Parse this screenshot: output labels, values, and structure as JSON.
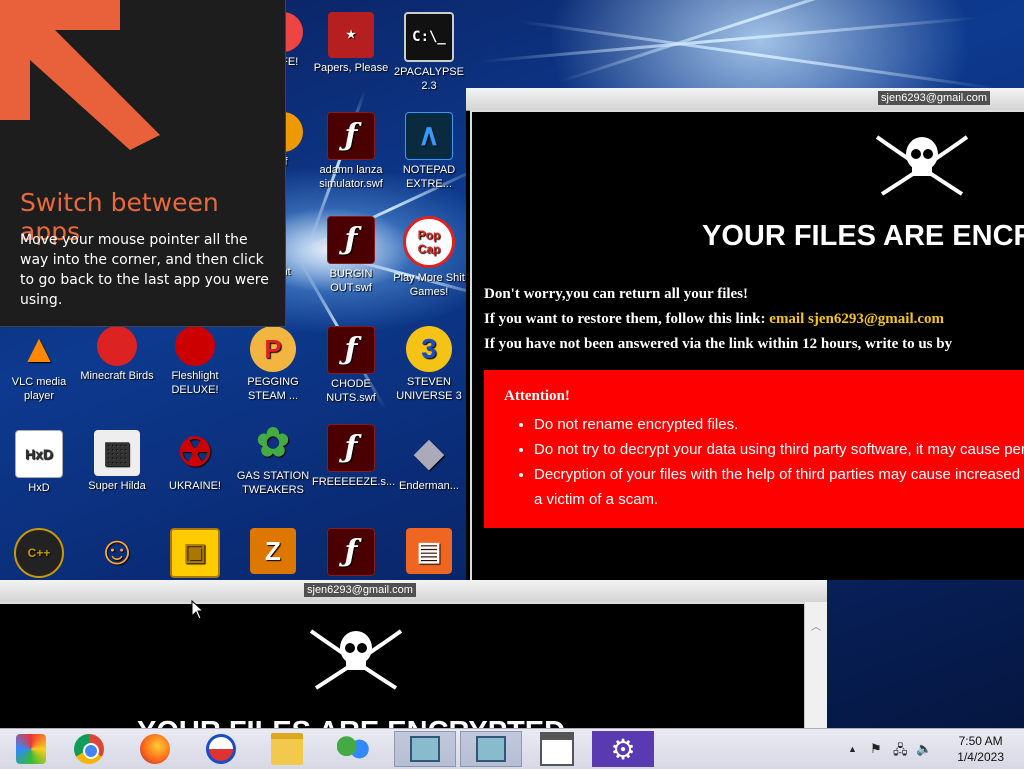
{
  "desktop": {
    "icons": [
      {
        "label": "WIFE!",
        "glyph": "●",
        "color": "#e44"
      },
      {
        "label": "Papers, Please",
        "glyph": "★",
        "color": "#c22"
      },
      {
        "label": "2PACALYPSE 2.3",
        "glyph": "C:\\_",
        "color": "#111"
      },
      {
        "label": "of",
        "glyph": "●",
        "color": "#e90"
      },
      {
        "label": "adamn lanza simulator.swf",
        "glyph": "ƒ",
        "color": "#4a0000"
      },
      {
        "label": "NOTEPAD EXTRE...",
        "glyph": "∧",
        "color": "#0a2a40"
      },
      {
        "label": "ght",
        "glyph": "",
        "color": ""
      },
      {
        "label": "BURGIN OUT.swf",
        "glyph": "ƒ",
        "color": "#4a0000"
      },
      {
        "label": "Play More Shit Games!",
        "glyph": "Pop Cap",
        "color": "#d22"
      },
      {
        "label": "VLC media player",
        "glyph": "▲",
        "color": "#f80"
      },
      {
        "label": "Minecraft Birds",
        "glyph": "●",
        "color": "#d22"
      },
      {
        "label": "Fleshlight DELUXE!",
        "glyph": "●",
        "color": "#c00"
      },
      {
        "label": "PEGGING STEAM ...",
        "glyph": "P",
        "color": "#d33"
      },
      {
        "label": "CHODE NUTS.swf",
        "glyph": "ƒ",
        "color": "#4a0000"
      },
      {
        "label": "STEVEN UNIVERSE 3",
        "glyph": "3",
        "color": "#36c"
      },
      {
        "label": "HxD",
        "glyph": "HxD",
        "color": "#fff"
      },
      {
        "label": "Super Hilda",
        "glyph": "▦",
        "color": "#eee"
      },
      {
        "label": "UKRAINE!",
        "glyph": "☢",
        "color": "#c00"
      },
      {
        "label": "GAS STATION TWEAKERS",
        "glyph": "✿",
        "color": "#4a4"
      },
      {
        "label": "FREEEEEZE.s...",
        "glyph": "ƒ",
        "color": "#4a0000"
      },
      {
        "label": "Enderman...",
        "glyph": "◆",
        "color": "#99a"
      },
      {
        "label": "",
        "glyph": "C++",
        "color": "#c90"
      },
      {
        "label": "",
        "glyph": "☺",
        "color": "#fa3"
      },
      {
        "label": "",
        "glyph": "▣",
        "color": "#fc0"
      },
      {
        "label": "",
        "glyph": "Z",
        "color": "#d70"
      },
      {
        "label": "",
        "glyph": "ƒ",
        "color": "#4a0000"
      },
      {
        "label": "",
        "glyph": "▤",
        "color": "#e62"
      }
    ]
  },
  "tip": {
    "title": "Switch between apps",
    "body": "Move your mouse pointer all the way into the corner, and then click to go back to the last app you were using."
  },
  "ransom_main": {
    "title": "sjen6293@gmail.com",
    "headline": "YOUR FILES ARE ENCRYPTED",
    "line1": "Don't worry,you can return all your files!",
    "line2_prefix": "If you want to restore them, follow this link: ",
    "line2_email": "email sjen6293@gmail.com",
    "line3": "If you have not been answered via the link within 12 hours, write to us by",
    "attention_title": "Attention!",
    "attention_items": [
      "Do not rename encrypted files.",
      "Do not try to decrypt your data using third party software, it may cause permanent data loss.",
      "Decryption of your files with the help of third parties may cause increased price",
      "a victim of a scam."
    ]
  },
  "ransom_second": {
    "title": "sjen6293@gmail.com",
    "headline": "YOUR FILES ARE ENCRYPTED"
  },
  "taskbar": {
    "time": "7:50 AM",
    "date": "1/4/2023",
    "tray_expand": "▲",
    "tray_flag": "⚑",
    "tray_network": "🖧",
    "tray_volume": "🔈"
  }
}
